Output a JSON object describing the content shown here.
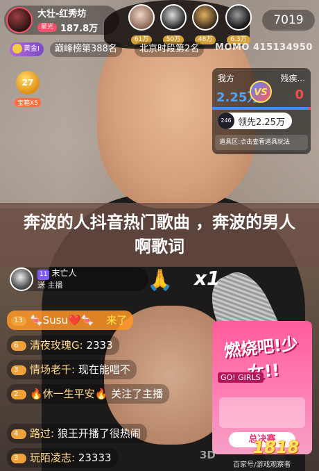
{
  "header": {
    "host_name": "大壮-红秀坊",
    "host_badge": "星光",
    "host_fans": "187.8万",
    "online_count": "7019",
    "viewers": [
      {
        "count": "61万"
      },
      {
        "count": "50万"
      },
      {
        "count": "48万"
      },
      {
        "count": "6.3万"
      }
    ]
  },
  "ranks": {
    "gold_badge": "黄金I",
    "peak_rank": "巅峰榜第388名",
    "city_rank": "北京时段第2名",
    "momo_id": "MOMO 415134950"
  },
  "treasure": {
    "count": "27",
    "label": "宝箱X5"
  },
  "pk": {
    "us_label": "我方",
    "them_label": "残疾...",
    "us_score": "2.25万",
    "them_score": "0",
    "vs": "VS",
    "lead_badge": "246",
    "lead_text": "领先2.25万",
    "prop_area": "道具区:点击查看道具玩法",
    "us_share": 0.98
  },
  "title_overlay": "奔波的人抖音热门歌曲 ，奔波的男人啊歌词",
  "gift": {
    "sender_level": "11",
    "sender": "末亡人",
    "action": "送 主播",
    "multiplier": "x1",
    "gift_emoji": "🙏"
  },
  "chat": [
    {
      "level": "13",
      "user": "🍬Susu❤️🍬",
      "msg": "来了",
      "highlight": true
    },
    {
      "level": "6",
      "user": "清夜玫瑰G:",
      "msg": "2333",
      "highlight": false
    },
    {
      "level": "3",
      "user": "情场老千:",
      "msg": "现在能唱不",
      "highlight": false
    },
    {
      "level": "2",
      "user": "🔥休一生平安🔥",
      "msg": "关注了主播",
      "highlight": false
    },
    {
      "level": "4",
      "user": "路过:",
      "msg": "狼王开播了很热闹",
      "highlight": false
    },
    {
      "level": "3",
      "user": "玩陌凌志:",
      "msg": "23333",
      "highlight": false
    }
  ],
  "promo": {
    "headline": "燃烧吧!少女!!",
    "go_girls": "GO! GIRLS",
    "final": "总决赛"
  },
  "watermark": {
    "logo": "1818",
    "site": "百家号/游戏观察者",
    "mark": "3D"
  }
}
